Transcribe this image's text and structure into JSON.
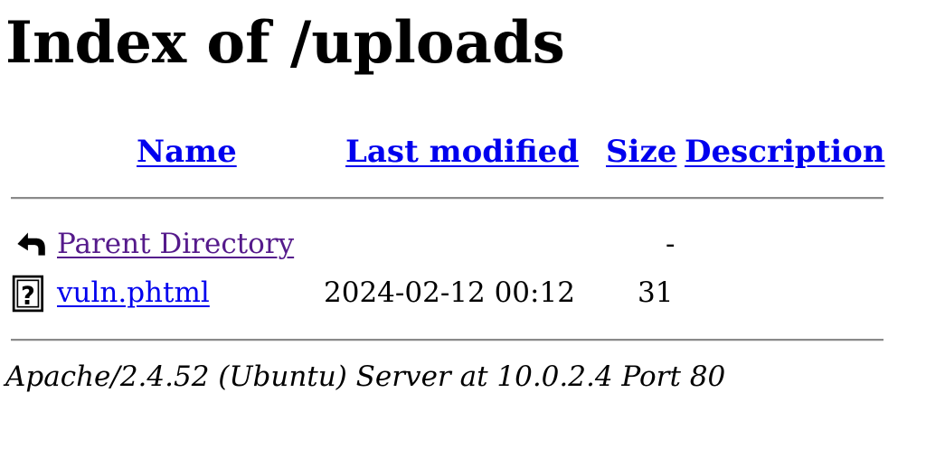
{
  "page": {
    "title": "Index of /uploads"
  },
  "columns": {
    "name": "Name",
    "last_modified": "Last modified",
    "size": "Size",
    "description": "Description"
  },
  "rows": [
    {
      "icon": "back-arrow-icon",
      "name": "Parent Directory",
      "last_modified": "",
      "size": "-",
      "description": ""
    },
    {
      "icon": "unknown-file-icon",
      "name": "vuln.phtml",
      "last_modified": "2024-02-12 00:12",
      "size": "31",
      "description": ""
    }
  ],
  "footer": {
    "address": "Apache/2.4.52 (Ubuntu) Server at 10.0.2.4 Port 80"
  },
  "colors": {
    "link": "#0000ee",
    "visited_link": "#551a8b",
    "rule": "#8a8a8a"
  }
}
